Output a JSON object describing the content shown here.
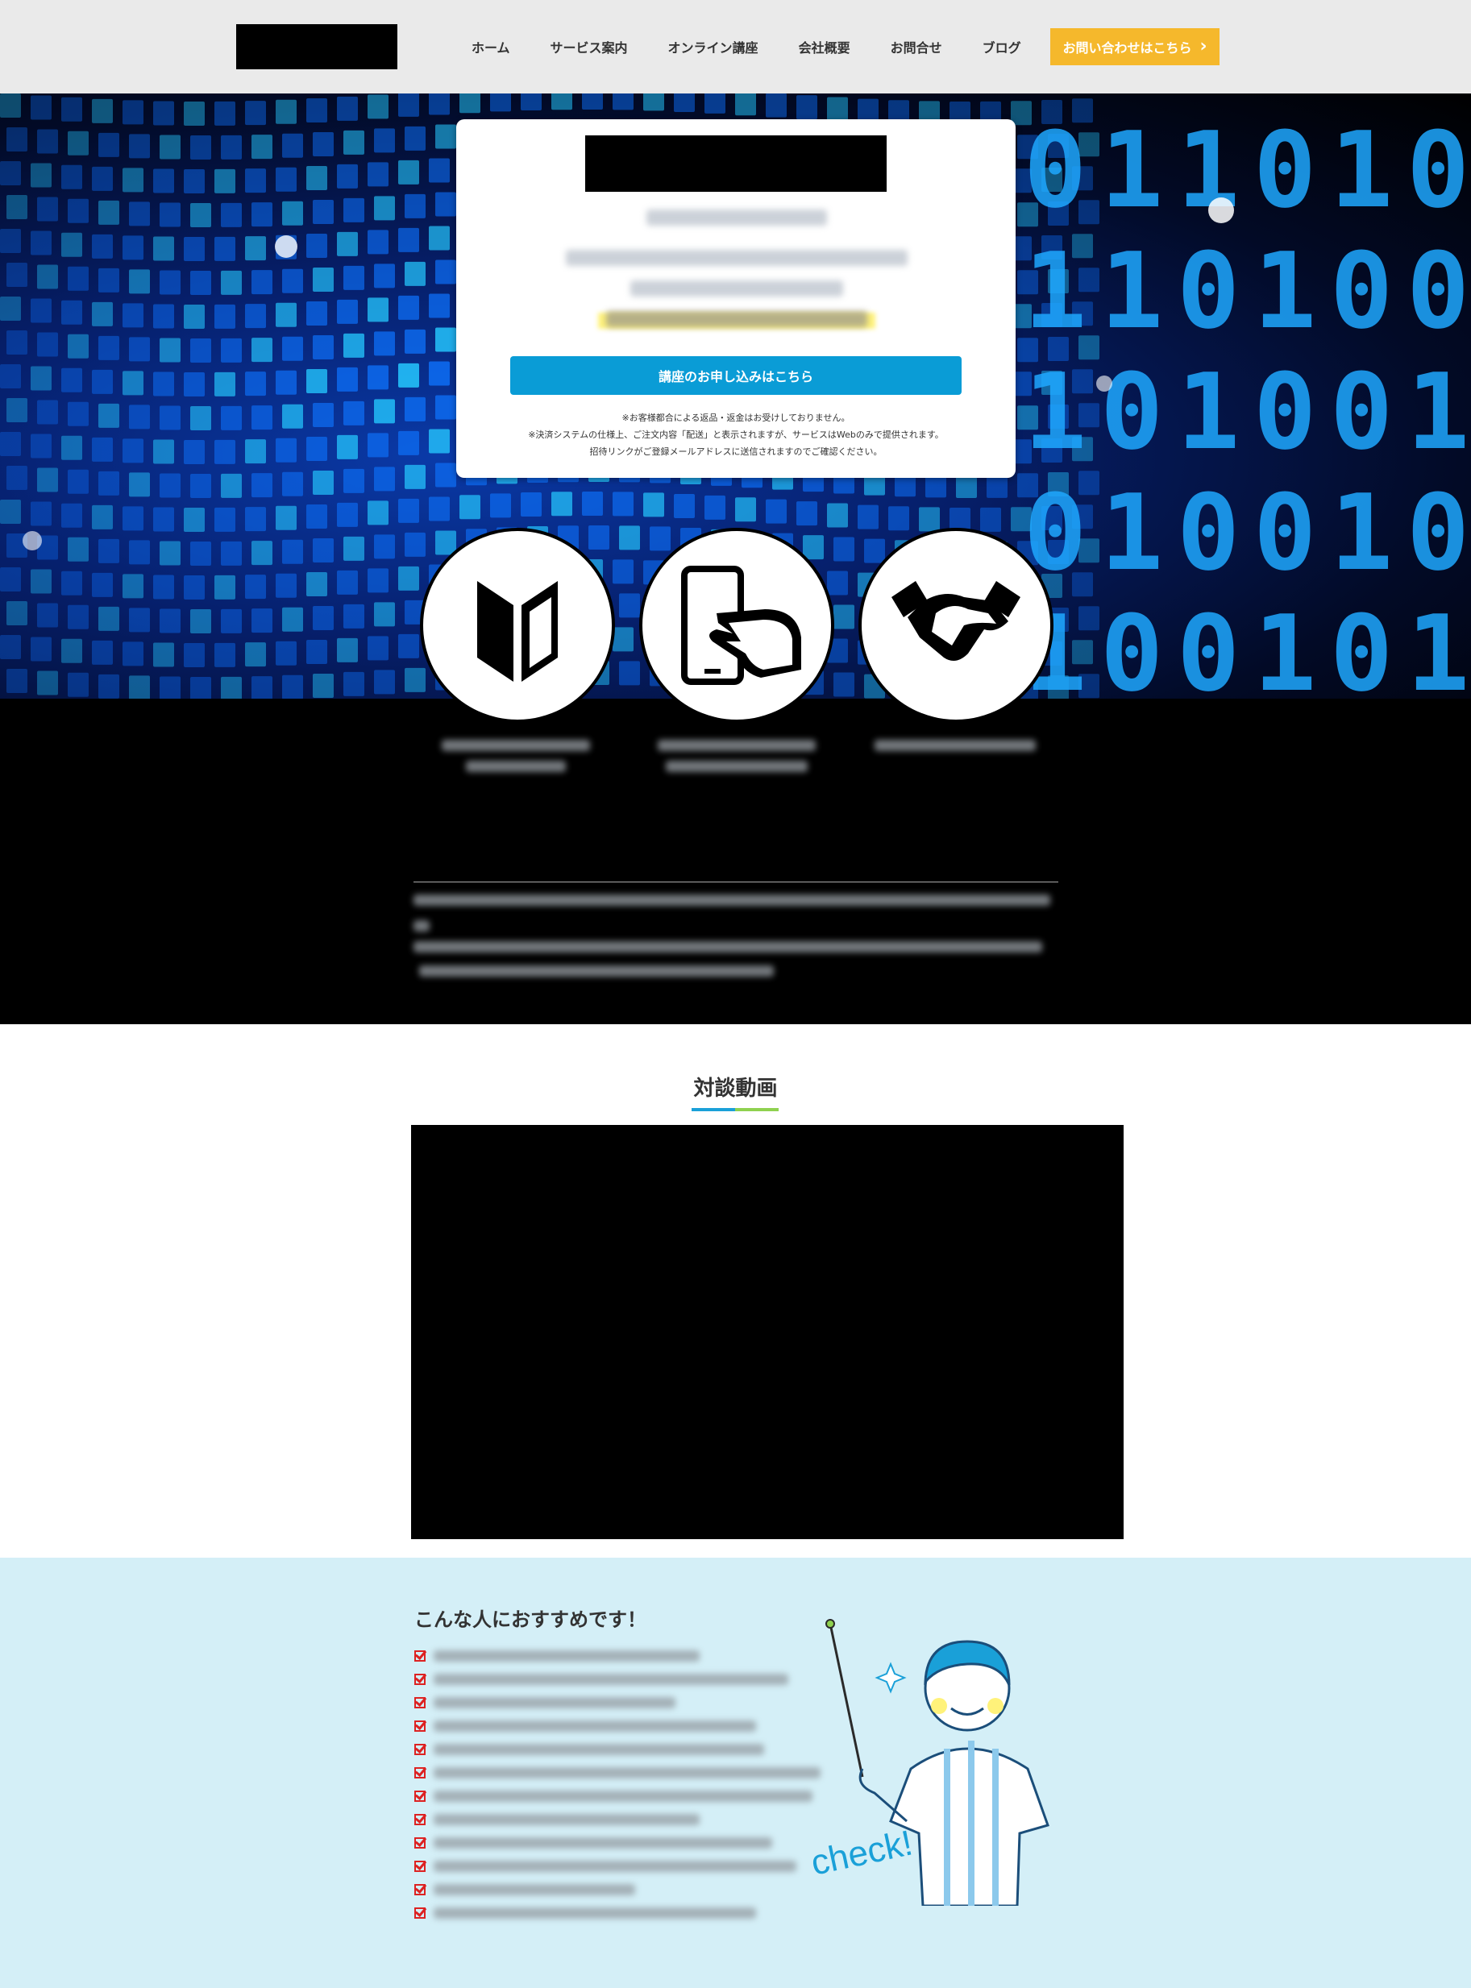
{
  "header": {
    "nav": [
      "ホーム",
      "サービス案内",
      "オンライン講座",
      "会社概要",
      "お問合せ",
      "ブログ"
    ],
    "cta_label": "お問い合わせはこちら",
    "cta_icon": "chevron-right-icon"
  },
  "hero": {
    "apply_button": "講座のお申し込みはこちら",
    "notes": [
      "※お客様都合による返品・返金はお受けしておりません。",
      "※決済システムの仕様上、ご注文内容「配送」と表示されますが、サービスはWebのみで提供されます。",
      "招待リンクがご登録メールアドレスに送信されますのでご確認ください。"
    ],
    "features": [
      {
        "icon": "beginner-mark-icon"
      },
      {
        "icon": "smartphone-tap-icon"
      },
      {
        "icon": "handshake-icon"
      }
    ]
  },
  "video_section": {
    "title": "対談動画",
    "underline_colors": [
      "#1aa0d8",
      "#8fd14f"
    ]
  },
  "recommend": {
    "title": "こんな人におすすめです！",
    "check_count": 12,
    "illustration_text": "check!",
    "check_color": "#d22222",
    "illustration_icon": "teacher-pointer-icon"
  },
  "colors": {
    "header_bg": "#eaeaea",
    "cta": "#f5b82c",
    "apply_button": "#0a9cd6",
    "recommend_bg": "#d4eff7"
  }
}
